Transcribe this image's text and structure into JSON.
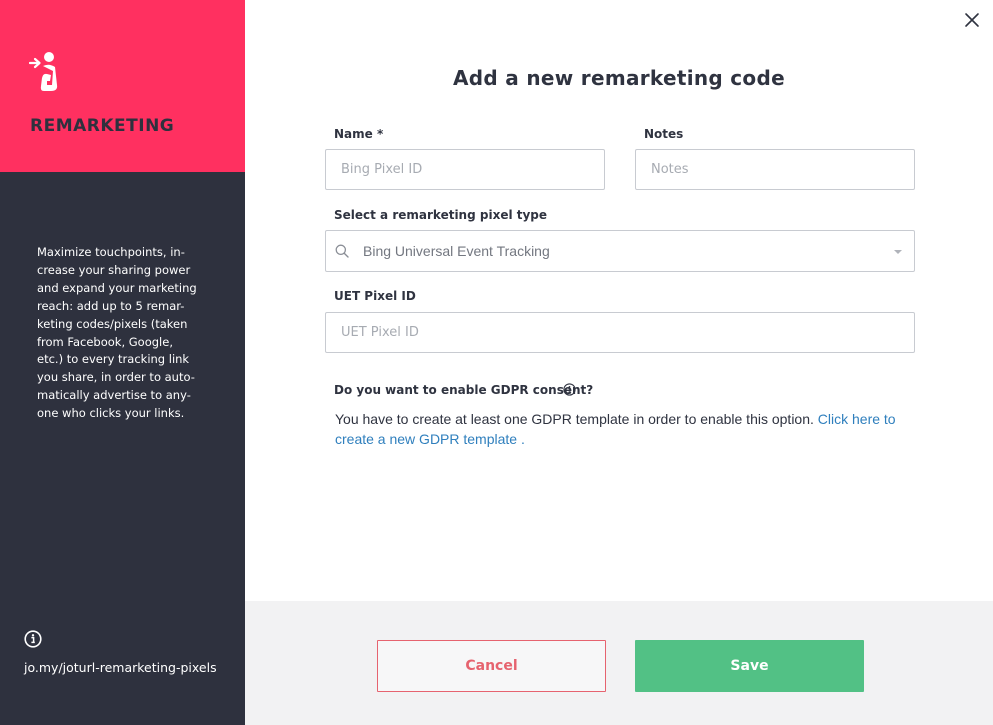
{
  "sidebar": {
    "title": "REMARKETING",
    "description": "Maximize touchpoints, in-\ncrease your sharing power\nand expand your marketing\nreach: add up to 5 remar-\nketing codes/pixels (taken\nfrom Facebook, Google,\netc.) to every tracking link\nyou share, in order to auto-\nmatically advertise to any-\none who clicks your links.",
    "link": "jo.my/joturl-remarketing-pixels",
    "colors": {
      "header": "#ff3060",
      "background": "#2e313e"
    },
    "icons": {
      "brand": "person-enter-icon",
      "info": "info-circle-icon"
    }
  },
  "dialog": {
    "title": "Add a new remarketing code",
    "close_icon": "close-icon",
    "name": {
      "label": "Name *",
      "placeholder": "Bing Pixel ID",
      "value": ""
    },
    "notes": {
      "label": "Notes",
      "placeholder": "Notes",
      "value": ""
    },
    "pixel_type": {
      "label": "Select a remarketing pixel type",
      "value": "Bing Universal Event Tracking",
      "icon": "search-icon"
    },
    "uet": {
      "label": "UET Pixel ID",
      "placeholder": "UET Pixel ID",
      "value": ""
    },
    "gdpr": {
      "label": "Do you want to enable GDPR consent?",
      "text": "You have to create at least one GDPR template in order to enable this option. ",
      "link": "Click here to create a new GDPR template",
      "suffix": " ."
    }
  },
  "footer": {
    "cancel": "Cancel",
    "save": "Save",
    "colors": {
      "cancel": "#e6636f",
      "save": "#52c185"
    }
  }
}
